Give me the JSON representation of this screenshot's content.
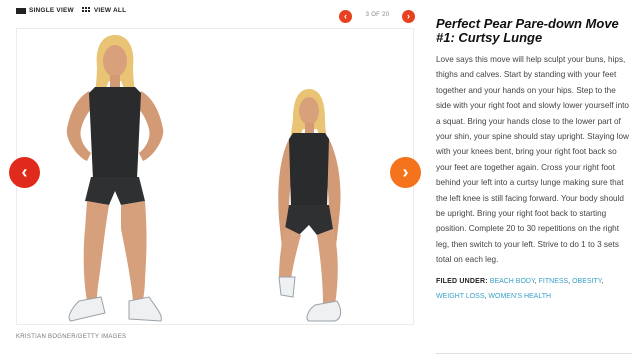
{
  "view_toggle": {
    "single_label": "SINGLE VIEW",
    "all_label": "VIEW ALL"
  },
  "pager": {
    "prev_glyph": "‹",
    "next_glyph": "›",
    "count": "3 OF 20"
  },
  "slider": {
    "prev_glyph": "‹",
    "next_glyph": "›"
  },
  "photo": {
    "credit": "KRISTIAN BOGNER/GETTY IMAGES"
  },
  "caption": {
    "title": "Perfect Pear Pare-down Move #1: Curtsy Lunge",
    "body": "Love says this move will help sculpt your buns, hips, thighs and calves. Start by standing with your feet together and your hands on your hips. Step to the side with your right foot and slowly lower yourself into a squat. Bring your hands close to the lower part of your shin, your spine should stay upright. Staying low with your knees bent, bring your right foot back so your feet are together again. Cross your right foot behind your left into a curtsy lunge making sure that the left knee is still facing forward. Your body should be upright. Bring your right foot back to starting position. Complete 20 to 30 repetitions on the right leg, then switch to your left. Strive to do 1 to 3 sets total on each leg.",
    "filed_under_label": "FILED UNDER:",
    "tags": [
      "BEACH BODY",
      "FITNESS",
      "OBESITY",
      "WEIGHT LOSS",
      "WOMEN'S HEALTH"
    ]
  },
  "colors": {
    "accent_red": "#e02a1c",
    "accent_orange": "#f4731c",
    "link": "#3aa0c8"
  },
  "icons": [
    "single-view-icon",
    "grid-view-icon",
    "chevron-left-icon",
    "chevron-right-icon"
  ]
}
